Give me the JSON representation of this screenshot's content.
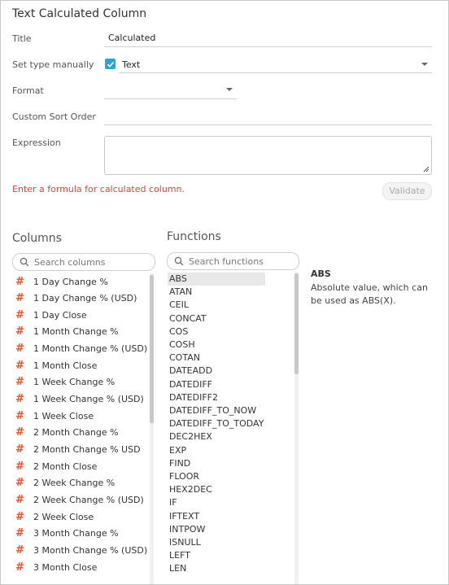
{
  "dialog": {
    "title": "Text Calculated Column"
  },
  "form": {
    "title_label": "Title",
    "title_value": "Calculated",
    "set_type_label": "Set type manually",
    "type_value": "Text",
    "format_label": "Format",
    "sort_label": "Custom Sort Order",
    "expression_label": "Expression",
    "error_message": "Enter a formula for calculated column.",
    "validate_label": "Validate"
  },
  "columns": {
    "heading": "Columns",
    "search_placeholder": "Search columns",
    "items": [
      "1 Day Change %",
      "1 Day Change % (USD)",
      "1 Day Close",
      "1 Month Change %",
      "1 Month Change % (USD)",
      "1 Month Close",
      "1 Week Change %",
      "1 Week Change % (USD)",
      "1 Week Close",
      "2 Month Change %",
      "2 Month Change % USD",
      "2 Month Close",
      "2 Week Change %",
      "2 Week Change % (USD)",
      "2 Week Close",
      "3 Month Change %",
      "3 Month Change % (USD)",
      "3 Month Close"
    ],
    "item_icon": "#"
  },
  "functions": {
    "heading": "Functions",
    "search_placeholder": "Search functions",
    "selected": "ABS",
    "items": [
      "ABS",
      "ATAN",
      "CEIL",
      "CONCAT",
      "COS",
      "COSH",
      "COTAN",
      "DATEADD",
      "DATEDIFF",
      "DATEDIFF2",
      "DATEDIFF_TO_NOW",
      "DATEDIFF_TO_TODAY",
      "DEC2HEX",
      "EXP",
      "FIND",
      "FLOOR",
      "HEX2DEC",
      "IF",
      "IFTEXT",
      "INTPOW",
      "ISNULL",
      "LEFT",
      "LEN"
    ]
  },
  "detail": {
    "name": "ABS",
    "description": "Absolute value, which can be used as ABS(X)."
  },
  "colors": {
    "accent": "#29a6d6",
    "error": "#e0443c",
    "hash_icon": "#e8502a"
  }
}
